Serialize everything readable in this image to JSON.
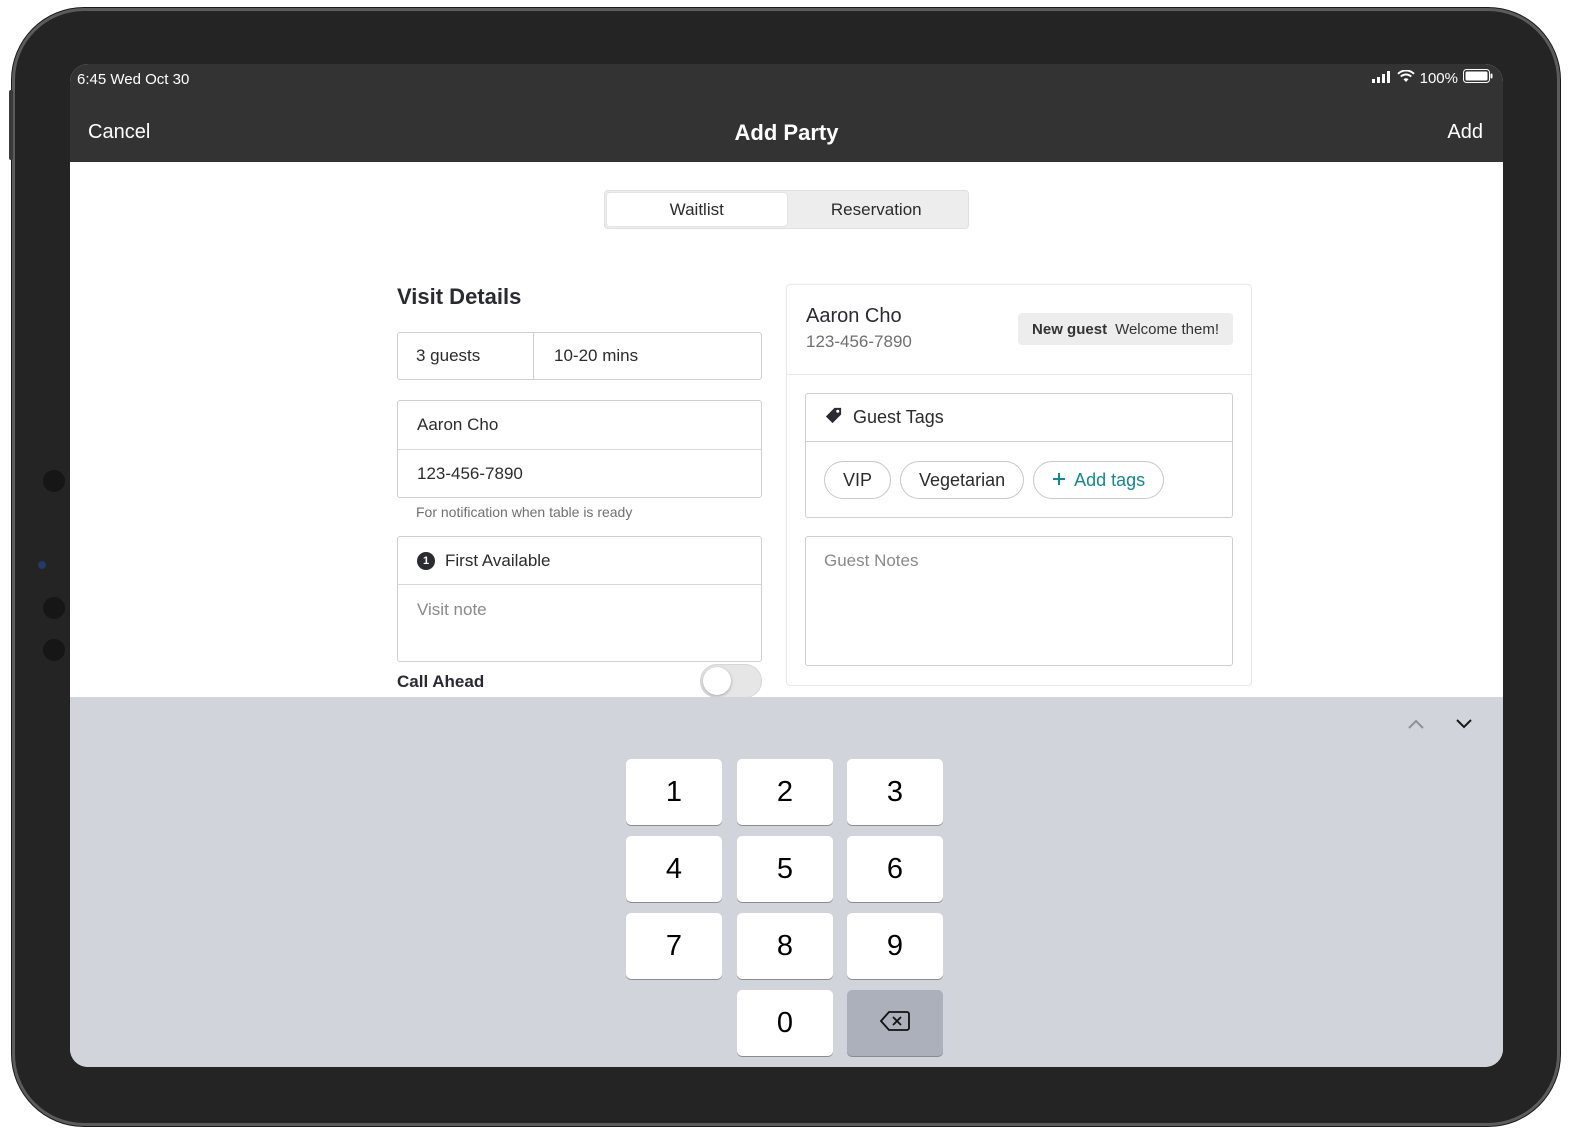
{
  "status": {
    "time": "6:45  Wed Oct 30",
    "battery": "100%"
  },
  "nav": {
    "cancel": "Cancel",
    "title": "Add Party",
    "add": "Add"
  },
  "mode_tabs": [
    {
      "label": "Waitlist",
      "selected": true
    },
    {
      "label": "Reservation",
      "selected": false
    }
  ],
  "visit": {
    "title": "Visit Details",
    "guests": "3 guests",
    "wait": "10-20 mins",
    "name": "Aaron Cho",
    "phone": "123-456-7890",
    "phone_hint": "For notification when table is ready",
    "seating_badge": "1",
    "seating": "First Available",
    "note_placeholder": "Visit note",
    "call_ahead": "Call Ahead",
    "call_ahead_on": false
  },
  "guest": {
    "name": "Aaron Cho",
    "phone": "123-456-7890",
    "badge_strong": "New guest",
    "badge_text": "Welcome them!",
    "tags_title": "Guest Tags",
    "tags": [
      "VIP",
      "Vegetarian"
    ],
    "add_tags": "Add tags",
    "notes_placeholder": "Guest Notes"
  },
  "keypad": {
    "keys": [
      "1",
      "2",
      "3",
      "4",
      "5",
      "6",
      "7",
      "8",
      "9",
      "0"
    ],
    "accent_color": "#128891"
  }
}
